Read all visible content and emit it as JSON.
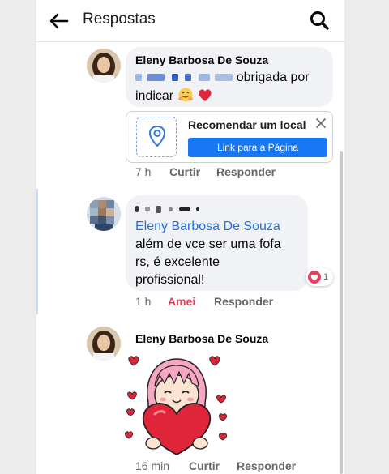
{
  "header": {
    "title": "Respostas",
    "back_icon": "back-arrow-icon",
    "search_icon": "search-icon"
  },
  "comments": [
    {
      "author": "Eleny Barbosa De Souza",
      "text_line1": "obrigada por",
      "text_line2": "indicar",
      "emojis": [
        "hugging-face-icon",
        "heart-icon"
      ],
      "link_card": {
        "title": "Recomendar um local",
        "button": "Link para a Página",
        "icon": "location-pin-icon"
      },
      "time": "7 h",
      "like": "Curtir",
      "reply": "Responder"
    },
    {
      "mention": "Eleny Barbosa De Souza",
      "text_line1": "além de vce ser uma fofa",
      "text_line2": "rs, é excelente",
      "text_line3": "profissional!",
      "reaction_count": "1",
      "time": "1 h",
      "like": "Amei",
      "reply": "Responder"
    },
    {
      "author": "Eleny Barbosa De Souza",
      "sticker": "girl-hugging-heart-sticker",
      "time": "16 min",
      "like": "Curtir",
      "reply": "Responder"
    }
  ],
  "colors": {
    "link_blue": "#216fdb",
    "button_blue": "#1877f2",
    "love_red": "#e4405f",
    "bubble_gray": "#f0f2f5",
    "meta_gray": "#65676b"
  }
}
